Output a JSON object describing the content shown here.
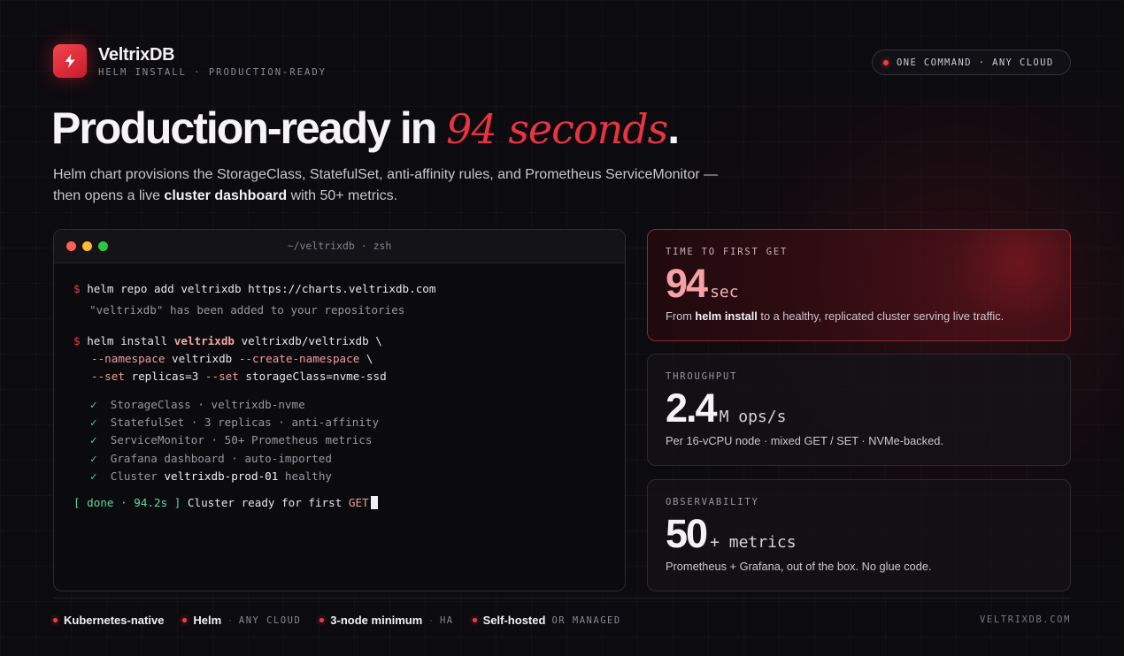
{
  "brand": {
    "name": "VeltrixDB",
    "tagline": "HELM INSTALL · PRODUCTION-READY",
    "logo_icon": "bolt-icon"
  },
  "pill": {
    "text": "ONE COMMAND · ANY CLOUD"
  },
  "hero": {
    "headline_prefix": "Production-ready in ",
    "headline_accent": "94 seconds",
    "headline_suffix": ".",
    "sub_part1": "Helm chart provisions the StorageClass, StatefulSet, anti-affinity rules, and Prometheus ServiceMonitor — then opens a live ",
    "sub_bold": "cluster dashboard",
    "sub_part2": " with 50+ metrics."
  },
  "terminal": {
    "title": "~/veltrixdb · zsh",
    "prompt": "$",
    "cmd1": "helm repo add veltrixdb https://charts.veltrixdb.com",
    "out1": "\"veltrixdb\" has been added to your repositories",
    "cmd2_a": "helm install ",
    "cmd2_release": "veltrixdb",
    "cmd2_b": " veltrixdb/veltrixdb \\",
    "flag_ns": "--namespace",
    "ns_val": " veltrixdb ",
    "flag_create": "--create-namespace",
    "ns_tail": " \\",
    "flag_set1": "--set",
    "set1_val": " replicas=3 ",
    "flag_set2": "--set",
    "set2_val": " storageClass=nvme-ssd",
    "check": "✓",
    "checks": [
      "StorageClass · veltrixdb-nvme",
      "StatefulSet · 3 replicas · anti-affinity",
      "ServiceMonitor · 50+ Prometheus metrics",
      "Grafana dashboard · auto-imported"
    ],
    "cluster_prefix": "Cluster ",
    "cluster_name": "veltrixdb-prod-01",
    "cluster_suffix": " healthy",
    "done_tag": "[ done · 94.2s ]",
    "done_text": " Cluster ready for first ",
    "done_get": "GET"
  },
  "cards": [
    {
      "label": "TIME TO FIRST GET",
      "value": "94",
      "unit": "sec",
      "desc_pre": "From ",
      "desc_bold": "helm install",
      "desc_post": " to a healthy, replicated cluster serving live traffic."
    },
    {
      "label": "THROUGHPUT",
      "value": "2.4",
      "unit": "M ops/s",
      "desc": "Per 16-vCPU node · mixed GET / SET · NVMe-backed."
    },
    {
      "label": "OBSERVABILITY",
      "value": "50",
      "unit": "+ metrics",
      "desc": "Prometheus + Grafana, out of the box. No glue code."
    }
  ],
  "footer": {
    "items": [
      {
        "bold": "Kubernetes-native",
        "sep": "",
        "muted": ""
      },
      {
        "bold": "Helm",
        "sep": "·",
        "muted": "ANY CLOUD"
      },
      {
        "bold": "3-node minimum",
        "sep": "·",
        "muted": "HA"
      },
      {
        "bold": "Self-hosted",
        "sep": "",
        "muted": "OR MANAGED"
      }
    ],
    "site": "VELTRIXDB.COM"
  },
  "colors": {
    "accent": "#e8343f",
    "background": "#0c0b0f",
    "success": "#52d39b"
  }
}
